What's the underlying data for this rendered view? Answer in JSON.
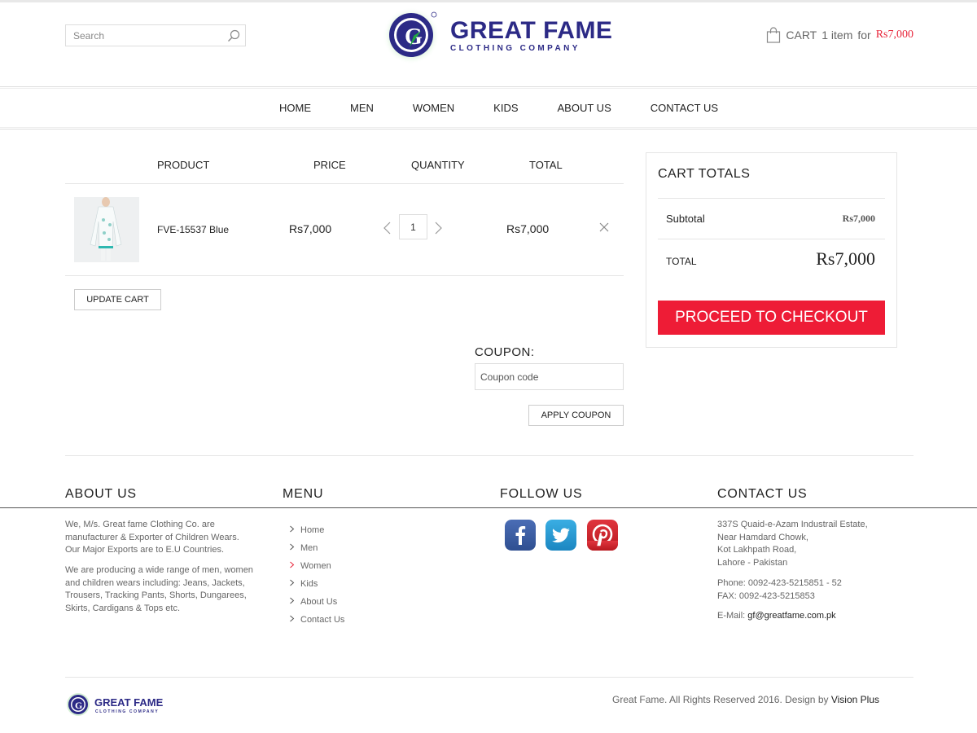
{
  "header": {
    "search_placeholder": "Search",
    "logo_name": "GREAT FAME",
    "logo_sub": "CLOTHING COMPANY",
    "cart_label": "CART",
    "cart_count": "1 item",
    "cart_for": "for",
    "cart_total": "Rs7,000"
  },
  "nav": [
    "HOME",
    "MEN",
    "WOMEN",
    "KIDS",
    "ABOUT US",
    "CONTACT US"
  ],
  "cart": {
    "columns": [
      "PRODUCT",
      "PRICE",
      "QUANTITY",
      "TOTAL"
    ],
    "items": [
      {
        "name": "FVE-15537 Blue",
        "price": "Rs7,000",
        "quantity": "1",
        "total": "Rs7,000"
      }
    ],
    "update_label": "UPDATE CART",
    "coupon_label": "COUPON:",
    "coupon_placeholder": "Coupon code",
    "apply_label": "APPLY COUPON"
  },
  "totals": {
    "title": "CART TOTALS",
    "subtotal_label": "Subtotal",
    "subtotal_value": "Rs7,000",
    "total_label": "TOTAL",
    "total_value": "Rs7,000",
    "checkout_label": "PROCEED TO CHECKOUT"
  },
  "footer": {
    "about": {
      "heading": "ABOUT US",
      "p1": "We, M/s. Great fame Clothing Co. are manufacturer & Exporter of Children Wears. Our Major Exports are to E.U Countries.",
      "p2": "We are producing a wide range of men, women and children wears including: Jeans, Jackets, Trousers, Tracking Pants, Shorts, Dungarees, Skirts, Cardigans & Tops etc."
    },
    "menu": {
      "heading": "MENU",
      "items": [
        "Home",
        "Men",
        "Women",
        "Kids",
        "About Us",
        "Contact Us"
      ]
    },
    "follow": {
      "heading": "FOLLOW US",
      "networks": [
        "facebook-icon",
        "twitter-icon",
        "pinterest-icon"
      ]
    },
    "contact": {
      "heading": "CONTACT US",
      "address": [
        "337S Quaid-e-Azam Industrail Estate,",
        "Near Hamdard Chowk,",
        "Kot Lakhpath Road,",
        "Lahore - Pakistan"
      ],
      "phone": "Phone: 0092-423-5215851 - 52",
      "fax": "FAX: 0092-423-5215853",
      "email_label": "E-Mail:",
      "email": "gf@greatfame.com.pk"
    },
    "logo_name": "GREAT FAME",
    "logo_sub": "CLOTHING COMPANY",
    "copyright": "Great Fame. All Rights Reserved 2016. Design by",
    "designer": "Vision Plus"
  },
  "colors": {
    "accent": "#ee1c36",
    "brand": "#2c2a86",
    "price_red": "#e8253a"
  }
}
